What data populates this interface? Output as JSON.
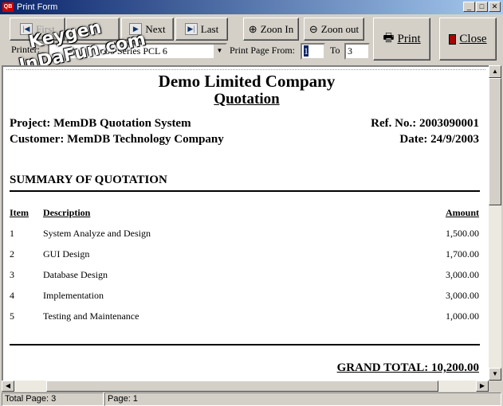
{
  "window": {
    "title": "Print Form",
    "app_icon": "QB"
  },
  "toolbar": {
    "first": "First",
    "prev": "Prev",
    "next": "Next",
    "last": "Last",
    "zoom_in": "Zoon In",
    "zoom_out": "Zoon out",
    "print": "Print",
    "close": "Close",
    "printer_label": "Printer:",
    "printer_value": "00 Series PCL 6",
    "print_from_label": "Print Page From:",
    "from_value": "1",
    "to_label": "To",
    "to_value": "3"
  },
  "watermark": [
    "Keygen",
    "InDaFun.com"
  ],
  "document": {
    "company": "Demo Limited Company",
    "doc_title": "Quotation",
    "project": "Project: MemDB Quotation System",
    "ref": "Ref. No.: 2003090001",
    "customer": "Customer: MemDB Technology Company",
    "date": "Date: 24/9/2003",
    "section": "SUMMARY OF QUOTATION",
    "headers": {
      "item": "Item",
      "description": "Description",
      "amount": "Amount"
    },
    "rows": [
      {
        "item": "1",
        "description": "System  Analyze and Design",
        "amount": "1,500.00"
      },
      {
        "item": "2",
        "description": "GUI Design",
        "amount": "1,700.00"
      },
      {
        "item": "3",
        "description": "Database Design",
        "amount": "3,000.00"
      },
      {
        "item": "4",
        "description": "Implementation",
        "amount": "3,000.00"
      },
      {
        "item": "5",
        "description": "Testing and Maintenance",
        "amount": "1,000.00"
      }
    ],
    "grand_total": "GRAND TOTAL: 10,200.00"
  },
  "status": {
    "total_pages": "Total Page: 3",
    "page": "Page: 1"
  }
}
